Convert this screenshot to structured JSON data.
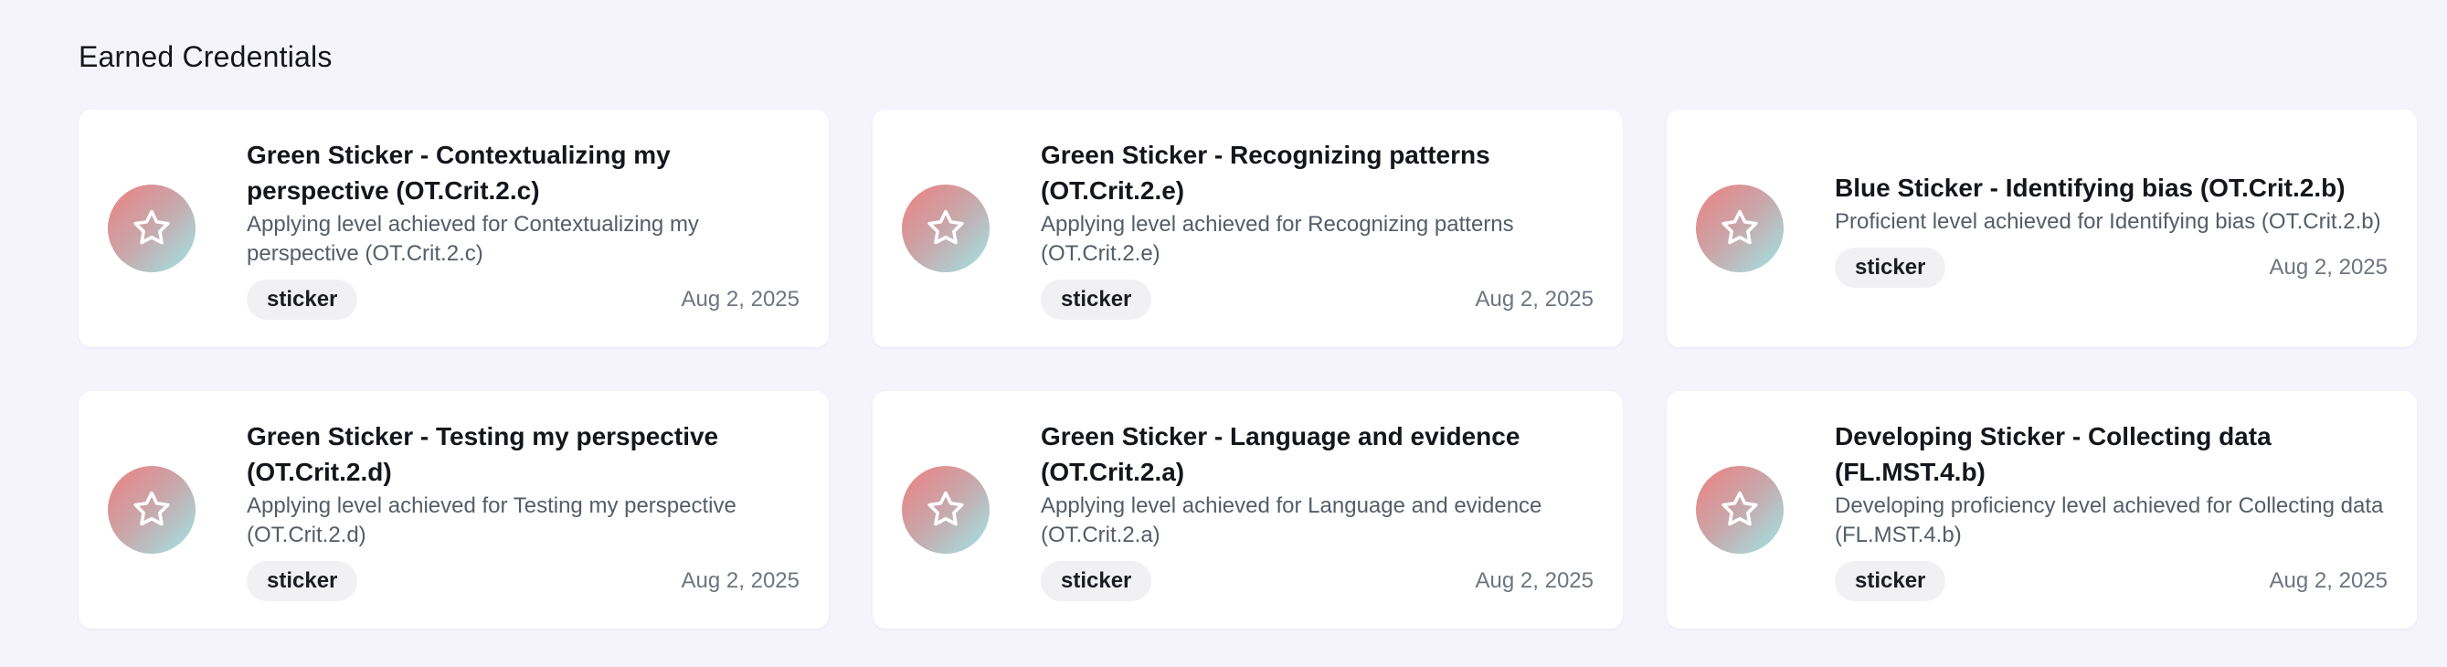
{
  "section": {
    "title": "Earned Credentials"
  },
  "credentials": [
    {
      "title": "Green Sticker - Contextualizing my perspective (OT.Crit.2.c)",
      "description": "Applying level achieved for Contextualizing my perspective (OT.Crit.2.c)",
      "tag": "sticker",
      "date": "Aug 2, 2025",
      "icon": "star-icon"
    },
    {
      "title": "Green Sticker - Recognizing patterns (OT.Crit.2.e)",
      "description": "Applying level achieved for Recognizing patterns (OT.Crit.2.e)",
      "tag": "sticker",
      "date": "Aug 2, 2025",
      "icon": "star-icon"
    },
    {
      "title": "Blue Sticker - Identifying bias (OT.Crit.2.b)",
      "description": "Proficient level achieved for Identifying bias (OT.Crit.2.b)",
      "tag": "sticker",
      "date": "Aug 2, 2025",
      "icon": "star-icon"
    },
    {
      "title": "Green Sticker - Testing my perspective (OT.Crit.2.d)",
      "description": "Applying level achieved for Testing my perspective (OT.Crit.2.d)",
      "tag": "sticker",
      "date": "Aug 2, 2025",
      "icon": "star-icon"
    },
    {
      "title": "Green Sticker - Language and evidence (OT.Crit.2.a)",
      "description": "Applying level achieved for Language and evidence (OT.Crit.2.a)",
      "tag": "sticker",
      "date": "Aug 2, 2025",
      "icon": "star-icon"
    },
    {
      "title": "Developing Sticker - Collecting data (FL.MST.4.b)",
      "description": "Developing proficiency level achieved for Collecting data (FL.MST.4.b)",
      "tag": "sticker",
      "date": "Aug 2, 2025",
      "icon": "star-icon"
    }
  ],
  "colors": {
    "page_background": "#f5f4fd",
    "badge_gradient_start": "#ee8080",
    "badge_gradient_end": "#9fe6e6",
    "tag_background": "#f1f1f3"
  }
}
